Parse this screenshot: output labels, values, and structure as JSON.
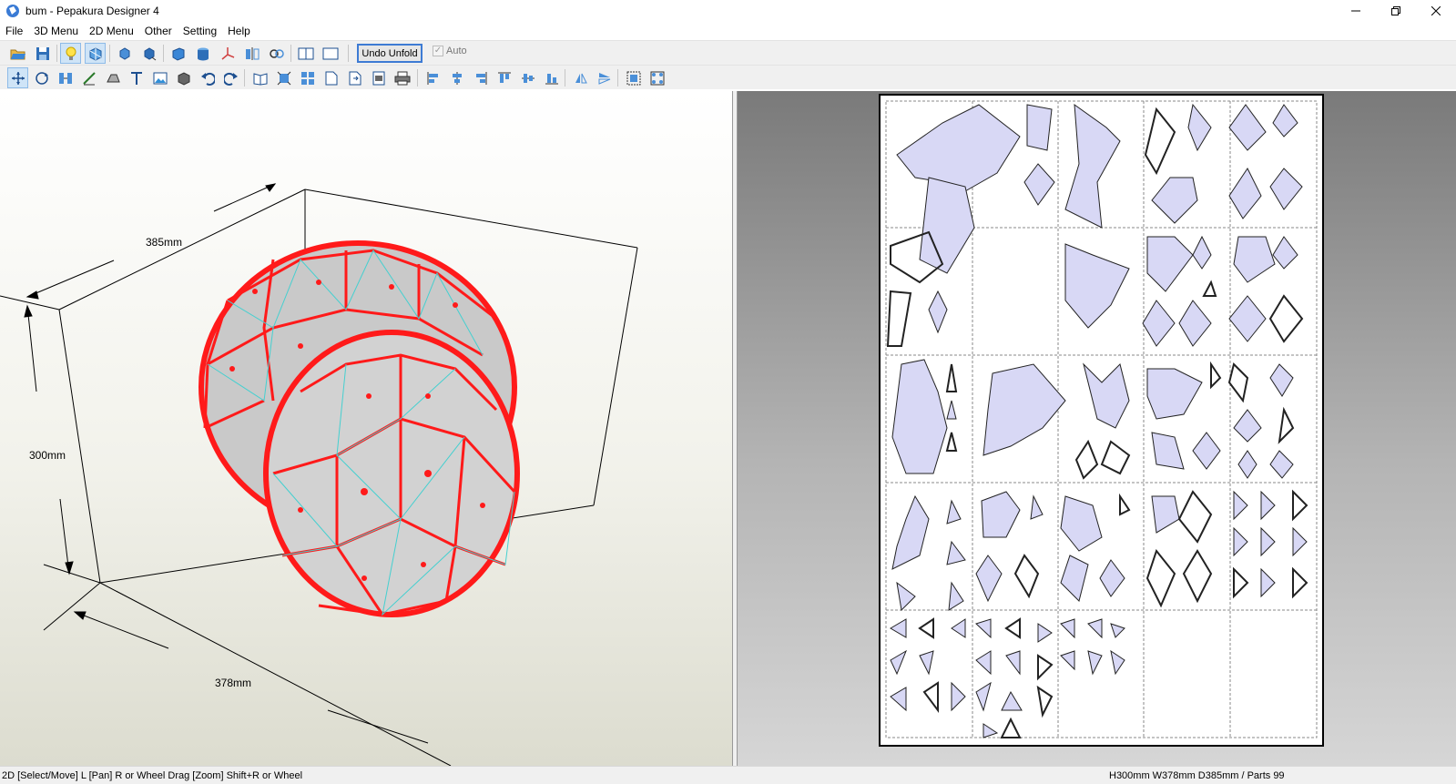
{
  "window": {
    "title": "bum - Pepakura Designer 4"
  },
  "menu": [
    "File",
    "3D Menu",
    "2D Menu",
    "Other",
    "Setting",
    "Help"
  ],
  "toolbar1": {
    "undo_unfold_label": "Undo Unfold",
    "auto_label": "Auto",
    "auto_checked": true,
    "icons": [
      "open-icon",
      "save-icon",
      "light-bulb-icon",
      "texture-icon",
      "rotate-left-icon",
      "rotate-right-icon",
      "cube-icon",
      "cylinder-icon",
      "axis-icon",
      "mirror-icon",
      "link-icon",
      "layout-split-icon",
      "layout-single-icon"
    ]
  },
  "toolbar2": {
    "icons": [
      "select-move-icon",
      "rotate-tool-icon",
      "join-edge-icon",
      "fold-line-icon",
      "flap-icon",
      "text-icon",
      "image-icon",
      "fold-3d-icon",
      "undo-icon",
      "redo-icon",
      "book-icon",
      "fit-icon",
      "arrange-icon",
      "page-icon",
      "page-next-icon",
      "page-print-icon",
      "print-icon",
      "align-left-icon",
      "align-center-icon",
      "align-right-icon",
      "align-top-icon",
      "align-middle-icon",
      "align-bottom-icon",
      "flip-h-icon",
      "flip-v-icon",
      "group-icon",
      "snap-icon"
    ]
  },
  "view3d": {
    "dim_depth": "385mm",
    "dim_height": "300mm",
    "dim_width": "378mm"
  },
  "statusbar": {
    "left": "2D [Select/Move] L [Pan] R or Wheel Drag [Zoom] Shift+R or Wheel",
    "right": "H300mm W378mm D385mm / Parts 99"
  },
  "colors": {
    "mesh_edge": "#ff1a1a",
    "fold_line": "#44d0d0",
    "part_fill": "#d8d8f5",
    "page_border": "#000000"
  }
}
